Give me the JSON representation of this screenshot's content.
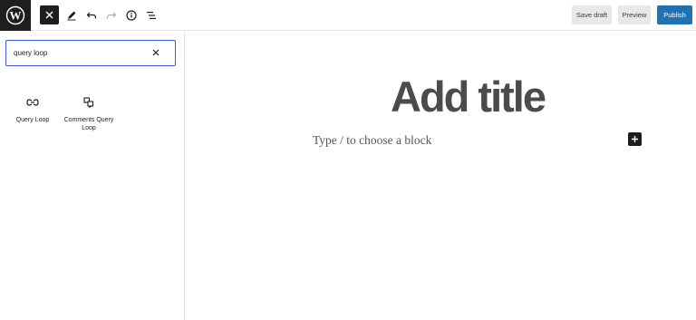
{
  "toolbar": {
    "logo_icon": "wordpress-logo-icon",
    "tools": [
      "close-icon",
      "pencil-icon",
      "undo-icon",
      "redo-icon",
      "info-icon",
      "list-view-icon"
    ],
    "save_draft_label": "Save draft",
    "preview_label": "Preview",
    "publish_label": "Publish",
    "accent_color": "#2271b1"
  },
  "inserter": {
    "search_value": "query loop",
    "clear_icon": "close-icon",
    "blocks": [
      {
        "label": "Query Loop",
        "icon": "query-loop-icon"
      },
      {
        "label": "Comments Query Loop",
        "icon": "comments-query-loop-icon"
      }
    ]
  },
  "editor": {
    "title_placeholder": "Add title",
    "block_placeholder": "Type / to choose a block",
    "add_block_icon": "plus-icon"
  }
}
